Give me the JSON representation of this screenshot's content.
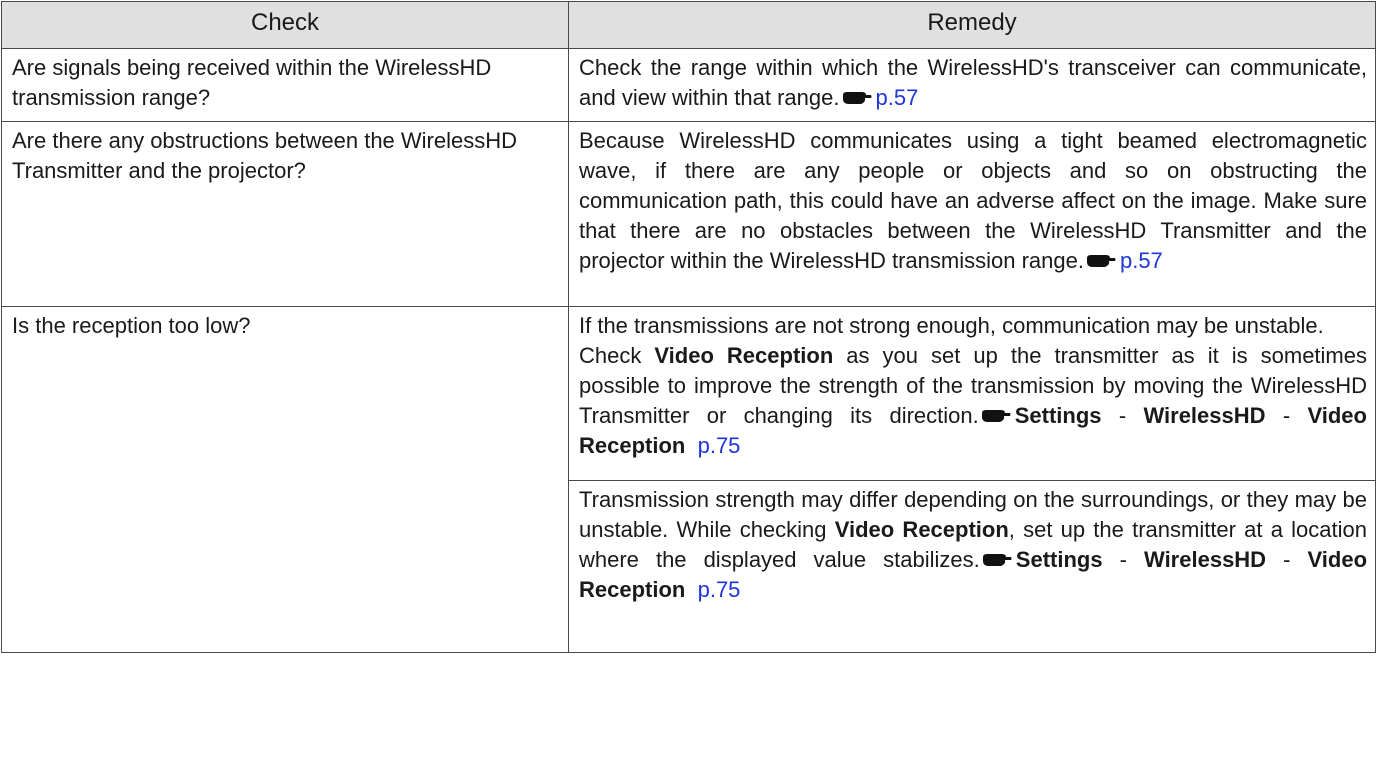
{
  "headers": {
    "check": "Check",
    "remedy": "Remedy"
  },
  "rows": [
    {
      "check": "Are signals being received within the WirelessHD transmission range?",
      "remedy": {
        "text": "Check the range within which the WirelessHD's transceiver can communicate, and view within that range.",
        "page": "p.57"
      }
    },
    {
      "check": "Are there any obstructions between the WirelessHD Transmitter and the projector?",
      "remedy": {
        "text": "Because WirelessHD communicates using a tight beamed electromagnetic wave, if there are any people or objects and so on obstructing the communication path, this could have an adverse affect on the image. Make sure that there are no obstacles between the WirelessHD Transmitter and the projector within the WirelessHD transmission range.",
        "page": "p.57"
      }
    },
    {
      "check": "Is the reception too low?",
      "remedies": [
        {
          "line1": "If the transmissions are not strong enough, communication may be unstable.",
          "pre": "Check",
          "bold": "Video Reception",
          "post": "as you set up the transmitter as it is sometimes possible to improve the strength of the transmission by moving the WirelessHD Transmitter or changing its direction.",
          "menu": [
            "Settings",
            "WirelessHD",
            "Video Reception"
          ],
          "sep": "-",
          "page": "p.75"
        },
        {
          "pre": "Transmission strength may differ depending on the surroundings, or they may be unstable. While checking",
          "bold": "Video Reception",
          "post": ", set up the transmitter at a location where the displayed value stabilizes.",
          "menu": [
            "Settings",
            "WirelessHD",
            "Video Reception"
          ],
          "sep": "-",
          "page": "p.75"
        }
      ]
    }
  ],
  "icons": {
    "reference": "pointing-hand-icon"
  },
  "colors": {
    "header_bg": "#e0e0e0",
    "link": "#1f34d9",
    "border": "#4a4a4a"
  }
}
